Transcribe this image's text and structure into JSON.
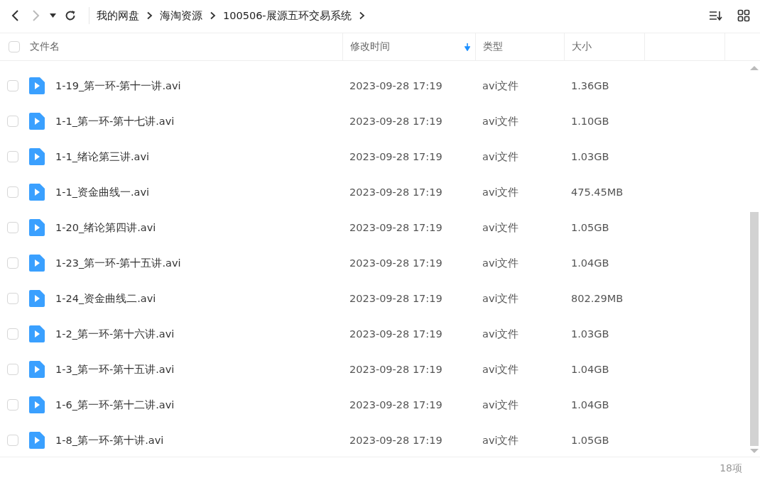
{
  "breadcrumbs": [
    "我的网盘",
    "海淘资源",
    "100506-展源五环交易系统"
  ],
  "select_all": {
    "checked": false
  },
  "columns": [
    {
      "label": "文件名",
      "sorted": false
    },
    {
      "label": "修改时间",
      "sorted": true
    },
    {
      "label": "类型",
      "sorted": false
    },
    {
      "label": "大小",
      "sorted": false
    }
  ],
  "rows": [
    {
      "name": "1-19_第一环-第十一讲.avi",
      "modified": "2023-09-28 17:19",
      "type": "avi文件",
      "size": "1.36GB",
      "checked": false
    },
    {
      "name": "1-1_第一环-第十七讲.avi",
      "modified": "2023-09-28 17:19",
      "type": "avi文件",
      "size": "1.10GB",
      "checked": false
    },
    {
      "name": "1-1_绪论第三讲.avi",
      "modified": "2023-09-28 17:19",
      "type": "avi文件",
      "size": "1.03GB",
      "checked": false
    },
    {
      "name": "1-1_资金曲线一.avi",
      "modified": "2023-09-28 17:19",
      "type": "avi文件",
      "size": "475.45MB",
      "checked": false
    },
    {
      "name": "1-20_绪论第四讲.avi",
      "modified": "2023-09-28 17:19",
      "type": "avi文件",
      "size": "1.05GB",
      "checked": false
    },
    {
      "name": "1-23_第一环-第十五讲.avi",
      "modified": "2023-09-28 17:19",
      "type": "avi文件",
      "size": "1.04GB",
      "checked": false
    },
    {
      "name": "1-24_资金曲线二.avi",
      "modified": "2023-09-28 17:19",
      "type": "avi文件",
      "size": "802.29MB",
      "checked": false
    },
    {
      "name": "1-2_第一环-第十六讲.avi",
      "modified": "2023-09-28 17:19",
      "type": "avi文件",
      "size": "1.03GB",
      "checked": false
    },
    {
      "name": "1-3_第一环-第十五讲.avi",
      "modified": "2023-09-28 17:19",
      "type": "avi文件",
      "size": "1.04GB",
      "checked": false
    },
    {
      "name": "1-6_第一环-第十二讲.avi",
      "modified": "2023-09-28 17:19",
      "type": "avi文件",
      "size": "1.04GB",
      "checked": false
    },
    {
      "name": "1-8_第一环-第十讲.avi",
      "modified": "2023-09-28 17:19",
      "type": "avi文件",
      "size": "1.05GB",
      "checked": false
    }
  ],
  "item_count": "18项"
}
